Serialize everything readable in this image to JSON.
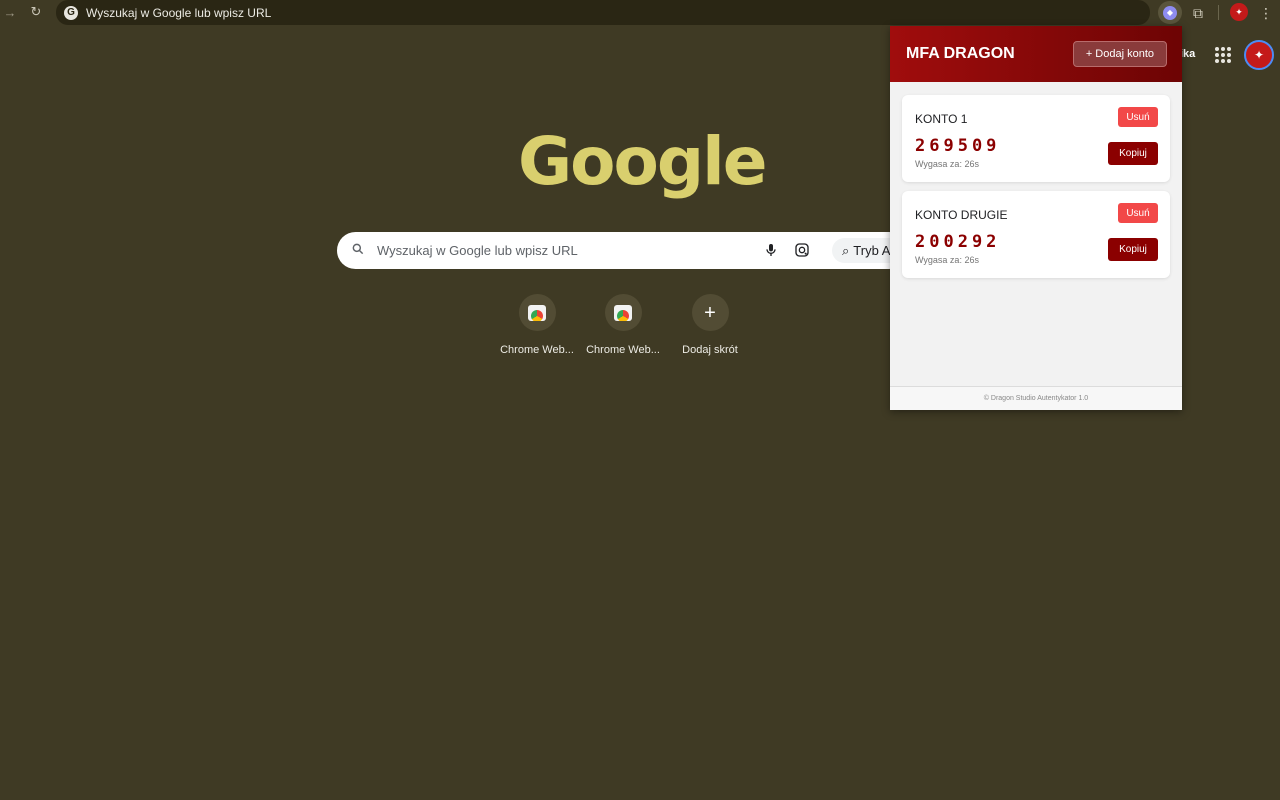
{
  "browser": {
    "omnibox_text": "Wyszukaj w Google lub wpisz URL"
  },
  "ntp": {
    "top_link": "ika",
    "logo_text": "Google",
    "search_placeholder": "Wyszukaj w Google lub wpisz URL",
    "ai_mode_label": "Tryb AI",
    "shortcuts": [
      {
        "label": "Chrome Web..."
      },
      {
        "label": "Chrome Web..."
      },
      {
        "label": "Dodaj skrót"
      }
    ]
  },
  "popup": {
    "title": "MFA DRAGON",
    "add_button": "+ Dodaj konto",
    "accounts": [
      {
        "name": "KONTO 1",
        "code": "269509",
        "expiry": "Wygasa za: 26s",
        "delete_label": "Usuń",
        "copy_label": "Kopiuj"
      },
      {
        "name": "KONTO DRUGIE",
        "code": "200292",
        "expiry": "Wygasa za: 26s",
        "delete_label": "Usuń",
        "copy_label": "Kopiuj"
      }
    ],
    "footer": "© Dragon Studio Autentykator 1.0"
  },
  "colors": {
    "background": "#3f3a24",
    "popup_header": "#8b0000",
    "code_color": "#8b0000",
    "delete_button": "#f24848",
    "logo": "#d9cf6e"
  }
}
